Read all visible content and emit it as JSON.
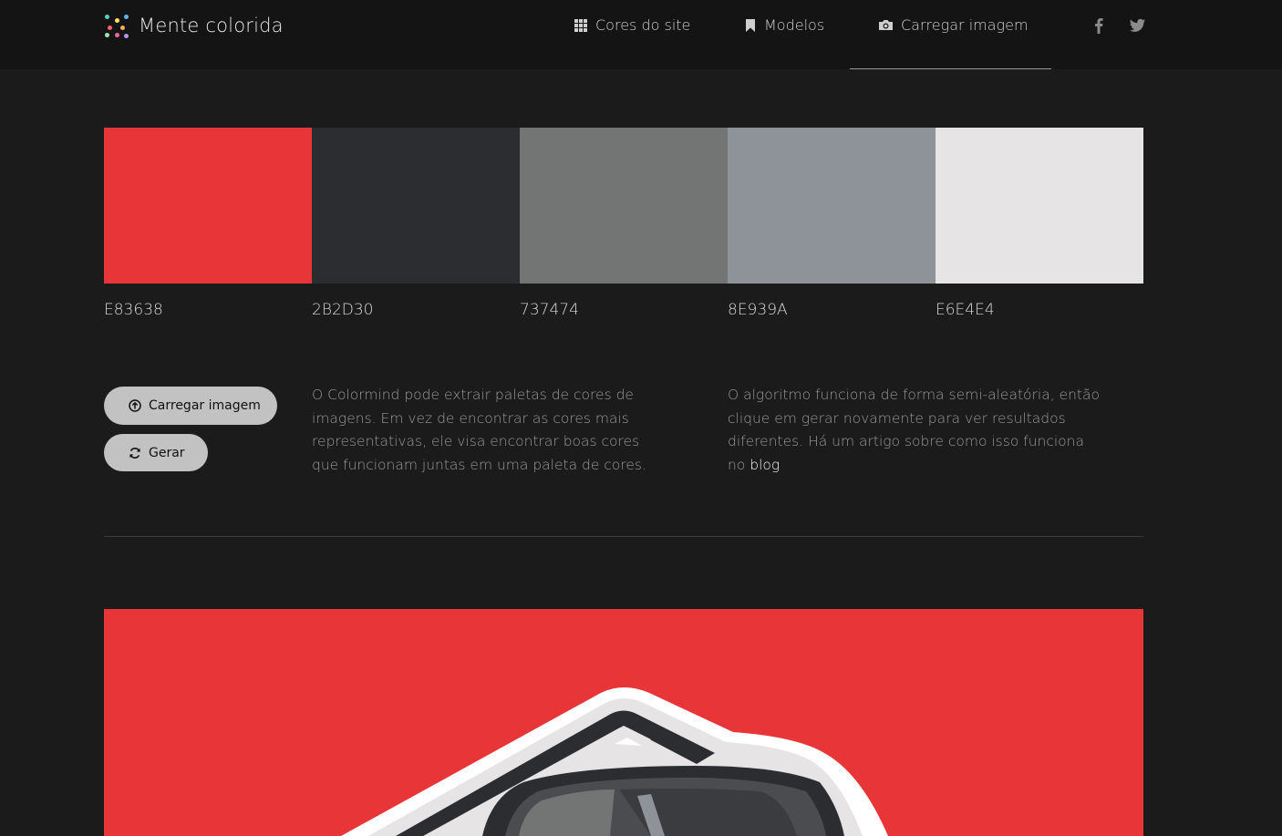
{
  "brand": {
    "name": "Mente colorida"
  },
  "nav": {
    "items": [
      {
        "label": "Cores do site",
        "icon": "grid-icon"
      },
      {
        "label": "Modelos",
        "icon": "bookmark-icon"
      },
      {
        "label": "Carregar imagem",
        "icon": "camera-icon",
        "active": true
      }
    ],
    "social": [
      {
        "icon": "facebook-icon"
      },
      {
        "icon": "twitter-icon"
      }
    ]
  },
  "palette": [
    {
      "hex": "E83638",
      "color": "#E83638"
    },
    {
      "hex": "2B2D30",
      "color": "#2B2D30"
    },
    {
      "hex": "737474",
      "color": "#737474"
    },
    {
      "hex": "8E939A",
      "color": "#8E939A"
    },
    {
      "hex": "E6E4E4",
      "color": "#E6E4E4"
    }
  ],
  "actions": {
    "upload_label": "Carregar imagem",
    "generate_label": "Gerar"
  },
  "text": {
    "description": "O Colormind pode extrair paletas de cores de imagens. Em vez de encontrar as cores mais representativas, ele visa encontrar boas cores que funcionam juntas em uma paleta de cores.",
    "algorithm": "O algoritmo funciona de forma semi-aleatória, então clique em gerar novamente para ver resultados diferentes. Há um artigo sobre como isso funciona no",
    "blog_link": "blog"
  }
}
